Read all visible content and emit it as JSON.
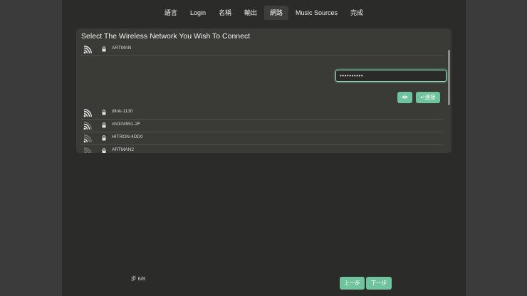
{
  "tabs": [
    {
      "label": "語言"
    },
    {
      "label": "Login"
    },
    {
      "label": "名稱"
    },
    {
      "label": "輸出"
    },
    {
      "label": "網路",
      "active": true
    },
    {
      "label": "Music Sources"
    },
    {
      "label": "完成"
    }
  ],
  "panel": {
    "title": "Select The Wireless Network You Wish To Connect",
    "selected_network": {
      "ssid": "ARTMAN",
      "icon": "wifi-icon",
      "locked": true
    },
    "password": {
      "value": "••••••••••",
      "masked": true
    },
    "show_password_icon": "eye-icon",
    "connect_label": "↵連接",
    "networks": [
      {
        "ssid": "dlink-1130",
        "locked": true
      },
      {
        "ssid": "cht104551-2F",
        "locked": true
      },
      {
        "ssid": "HITRON-4DD0",
        "locked": true
      },
      {
        "ssid": "ARTMAN2",
        "locked": true
      }
    ]
  },
  "footer": {
    "step": "步 6/8",
    "prev_label": "上一步",
    "next_label": "下一步"
  },
  "colors": {
    "accent": "#6fc49d",
    "background": "#2b2b29",
    "panel": "#3a3a37",
    "side": "#3b3b3b"
  }
}
